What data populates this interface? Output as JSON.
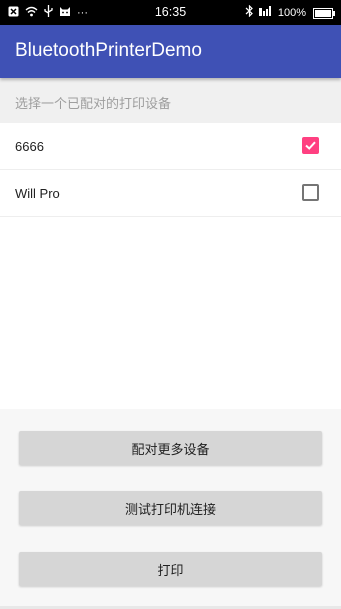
{
  "status_bar": {
    "time": "16:35",
    "battery": "100%",
    "battery_level": 1.0,
    "left_icons": [
      "notification-icon",
      "wifi-icon",
      "usb-icon",
      "cat-icon",
      "more-icon"
    ],
    "right_icons": [
      "bluetooth-icon",
      "signal-icon",
      "battery-icon"
    ]
  },
  "app_bar": {
    "title": "BluetoothPrinterDemo",
    "color": "#3f51b5"
  },
  "device_section": {
    "header": "选择一个已配对的打印设备",
    "devices": [
      {
        "name": "6666",
        "checked": true
      },
      {
        "name": "Will Pro",
        "checked": false
      }
    ]
  },
  "actions": {
    "pair_more": "配对更多设备",
    "test_connection": "测试打印机连接",
    "print": "打印"
  },
  "colors": {
    "accent": "#ff4081",
    "primary": "#3f51b5"
  }
}
